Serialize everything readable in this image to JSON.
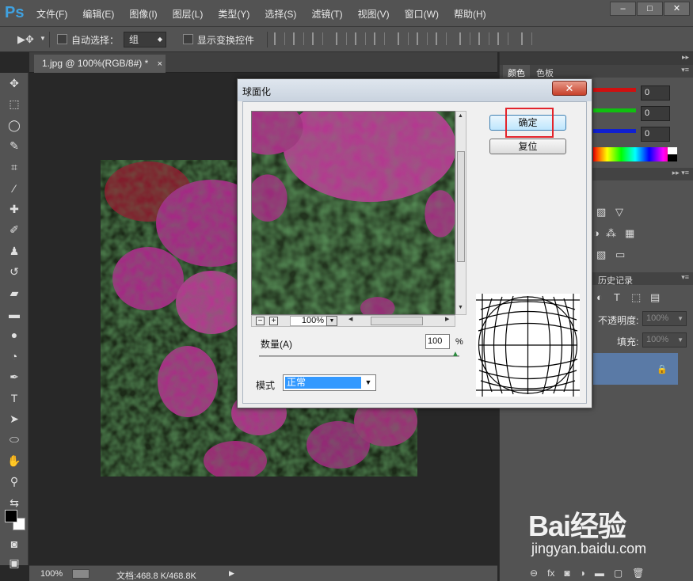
{
  "app": {
    "logo": "Ps"
  },
  "menu": [
    "文件(F)",
    "编辑(E)",
    "图像(I)",
    "图层(L)",
    "类型(Y)",
    "选择(S)",
    "滤镜(T)",
    "视图(V)",
    "窗口(W)",
    "帮助(H)"
  ],
  "window_buttons": [
    "–",
    "□",
    "✕"
  ],
  "options": {
    "auto_select_label": "自动选择：",
    "auto_select_value": "组",
    "show_transform_label": "显示变换控件"
  },
  "document_tab": {
    "title": "1.jpg @ 100%(RGB/8#) *",
    "close": "×"
  },
  "status": {
    "zoom": "100%",
    "doc_size": "文档:468.8 K/468.8K"
  },
  "panels": {
    "color_tabs": [
      "颜色",
      "色板"
    ],
    "rgb_values": [
      "0",
      "0",
      "0"
    ],
    "history_tab": "历史记录",
    "opacity_label": "不透明度:",
    "opacity_value": "100%",
    "fill_label": "填充:",
    "fill_value": "100%"
  },
  "dialog": {
    "title": "球面化",
    "close": "✕",
    "ok_label": "确定",
    "reset_label": "复位",
    "zoom_value": "100%",
    "amount_label": "数量(A)",
    "amount_value": "100",
    "amount_unit": "%",
    "amount_fraction": 1.0,
    "mode_label": "模式",
    "mode_value": "正常"
  },
  "watermark": {
    "logo": "Bai经验",
    "url": "jingyan.baidu.com"
  },
  "colors": {
    "accent_red": "#e3242b",
    "select_blue": "#3399ff",
    "ps_blue": "#3fa1e0"
  }
}
